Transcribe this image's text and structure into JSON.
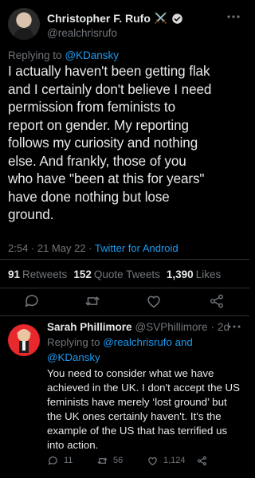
{
  "tweet": {
    "display_name": "Christopher F. Rufo",
    "name_emoji": "⚔️",
    "handle": "@realchrisrufo",
    "replying_prefix": "Replying to",
    "replying_to": "@KDansky",
    "text": "I actually haven't been getting flak\nand I certainly don't believe I need\npermission from feminists to\nreport on gender. My reporting\nfollows my curiosity and nothing\nelse. And frankly, those of you\nwho have \"been at this for years\"\nhave done nothing but lose\nground.",
    "time": "2:54 · 21 May 22 ·",
    "source": "Twitter for Android",
    "stats": {
      "retweets_count": "91",
      "retweets_label": "Retweets",
      "quotes_count": "152",
      "quotes_label": "Quote Tweets",
      "likes_count": "1,390",
      "likes_label": "Likes"
    }
  },
  "reply": {
    "display_name": "Sarah Phillimore",
    "handle": "@SVPhillimore",
    "separator": "·",
    "age": "2d",
    "replying_prefix": "Replying to",
    "replying_to": "@realchrisrufo and @KDansky",
    "text": "You need to consider what we have\nachieved in the UK. I don't accept the US\nfeminists have merely ‘lost ground’ but\nthe UK ones certainly haven't. It's the\nexample of the US that has terrified us\ninto action.",
    "reply_count": "11",
    "retweet_count": "56",
    "like_count": "1,124"
  },
  "colors": {
    "background": "#000000",
    "text": "#e7e9ea",
    "muted": "#71767b",
    "link": "#1d9bf0",
    "divider": "#2f3336",
    "avatar_reply_bg": "#e8282d"
  }
}
